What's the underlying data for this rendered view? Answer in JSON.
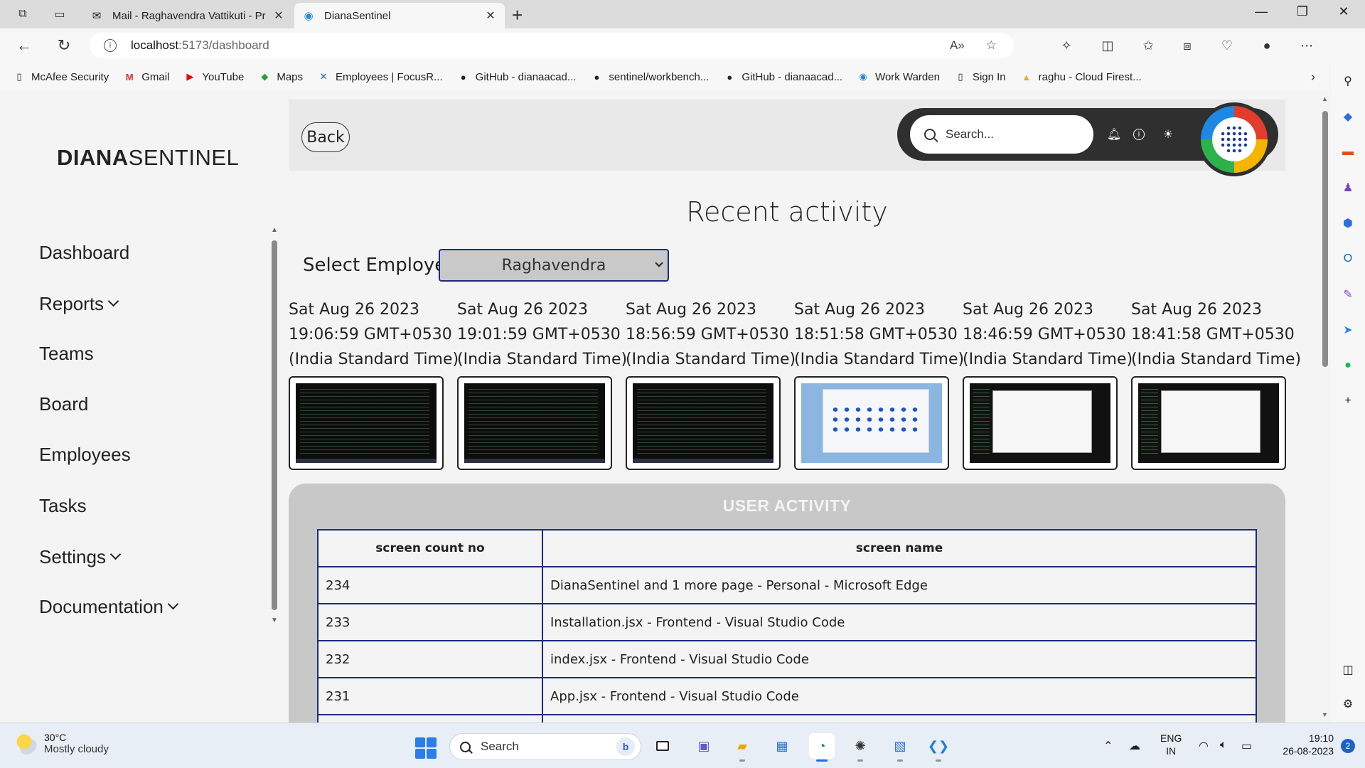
{
  "browser": {
    "tabs": [
      {
        "title": "Mail - Raghavendra Vattikuti - Pr",
        "icon": "mail-icon"
      },
      {
        "title": "DianaSentinel",
        "icon": "diana-sentinel-icon"
      }
    ],
    "url_host": "localhost",
    "url_path": ":5173/dashboard",
    "bookmarks": [
      {
        "label": "McAfee Security",
        "icon": "document-icon"
      },
      {
        "label": "Gmail",
        "icon": "gmail-icon"
      },
      {
        "label": "YouTube",
        "icon": "youtube-icon"
      },
      {
        "label": "Maps",
        "icon": "maps-icon"
      },
      {
        "label": "Employees | FocusR...",
        "icon": "focusr-icon"
      },
      {
        "label": "GitHub - dianaacad...",
        "icon": "github-icon"
      },
      {
        "label": "sentinel/workbench...",
        "icon": "github-icon"
      },
      {
        "label": "GitHub - dianaacad...",
        "icon": "github-icon"
      },
      {
        "label": "Work Warden",
        "icon": "work-warden-icon"
      },
      {
        "label": "Sign In",
        "icon": "document-icon"
      },
      {
        "label": "raghu - Cloud Firest...",
        "icon": "firebase-icon"
      }
    ]
  },
  "app": {
    "brand_bold": "DIANA",
    "brand_light": "SENTINEL",
    "nav": [
      "Dashboard",
      "Reports",
      "Teams",
      "Board",
      "Employees",
      "Tasks",
      "Settings",
      "Documentation"
    ],
    "back_label": "Back",
    "search_placeholder": "Search...",
    "page_title": "Recent activity",
    "select_label": "Select Employee",
    "selected_employee": "Raghavendra",
    "screenshots": [
      {
        "line1": "Sat Aug 26 2023",
        "line2": "19:06:59 GMT+0530",
        "line3": "(India Standard Time)",
        "kind": "code"
      },
      {
        "line1": "Sat Aug 26 2023",
        "line2": "19:01:59 GMT+0530",
        "line3": "(India Standard Time)",
        "kind": "code"
      },
      {
        "line1": "Sat Aug 26 2023",
        "line2": "18:56:59 GMT+0530",
        "line3": "(India Standard Time)",
        "kind": "code"
      },
      {
        "line1": "Sat Aug 26 2023",
        "line2": "18:51:58 GMT+0530",
        "line3": "(India Standard Time)",
        "kind": "explorer"
      },
      {
        "line1": "Sat Aug 26 2023",
        "line2": "18:46:59 GMT+0530",
        "line3": "(India Standard Time)",
        "kind": "window"
      },
      {
        "line1": "Sat Aug 26 2023",
        "line2": "18:41:58 GMT+0530",
        "line3": "(India Standard Time)",
        "kind": "window"
      }
    ],
    "activity": {
      "title": "USER ACTIVITY",
      "headers": [
        "screen count no",
        "screen name"
      ],
      "rows": [
        [
          "234",
          "DianaSentinel and 1 more page - Personal - Microsoft Edge"
        ],
        [
          "233",
          "Installation.jsx - Frontend - Visual Studio Code"
        ],
        [
          "232",
          "index.jsx - Frontend - Visual Studio Code"
        ],
        [
          "231",
          "App.jsx - Frontend - Visual Studio Code"
        ],
        [
          "",
          ""
        ]
      ]
    }
  },
  "taskbar": {
    "weather_temp": "30°C",
    "weather_desc": "Mostly cloudy",
    "search_label": "Search",
    "lang_1": "ENG",
    "lang_2": "IN",
    "time": "19:10",
    "date": "26-08-2023",
    "notifications": "2"
  },
  "colors": {
    "accent": "#1c2b7a",
    "header_pill": "#2f2f2f",
    "panel": "#c8c8c8"
  }
}
